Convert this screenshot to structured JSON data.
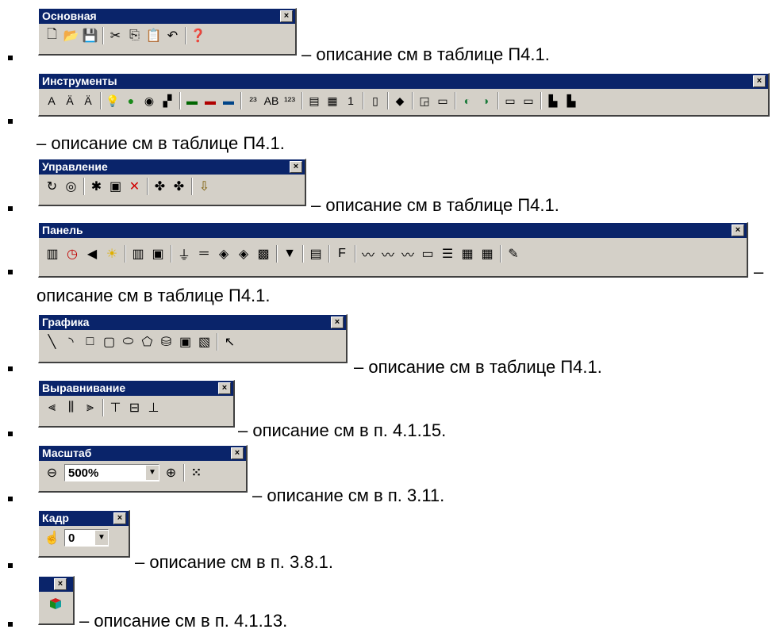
{
  "toolbars": [
    {
      "title": "Основная",
      "icons": [
        "new-icon",
        "open-icon",
        "save-icon",
        "|",
        "cut-icon",
        "copy-icon",
        "paste-icon",
        "undo-icon",
        "|",
        "help-icon"
      ],
      "desc": "– описание см в таблице П4.1."
    },
    {
      "title": "Инструменты",
      "icons": [
        "text-a-icon",
        "text-aa-icon",
        "text-aa2-icon",
        "|",
        "bulb-icon",
        "brush-icon",
        "dot-icon",
        "map-icon",
        "|",
        "num999-icon",
        "num999red-icon",
        "abc-icon",
        "|",
        "num23-icon",
        "ab-icon",
        "num123-icon",
        "|",
        "display-icon",
        "calc-icon",
        "num1-icon",
        "|",
        "gauge-icon",
        "|",
        "eraser-icon",
        "|",
        "frame-icon",
        "rect-icon",
        "|",
        "globe-icon",
        "globe2-icon",
        "|",
        "btn-icon",
        "btn2-icon",
        "|",
        "bars-icon",
        "bars2-icon"
      ],
      "desc": "– описание см в таблице П4.1."
    },
    {
      "title": "Управление",
      "icons": [
        "rotate-icon",
        "circle-icon",
        "|",
        "sparkle-icon",
        "props-icon",
        "delete-icon",
        "|",
        "link-icon",
        "link2-icon",
        "|",
        "import-icon"
      ],
      "desc": "– описание см в таблице П4.1."
    },
    {
      "title": "Панель",
      "icons": [
        "panel-icon",
        "clock-icon",
        "speaker-icon",
        "sun-icon",
        "|",
        "bars3-icon",
        "monitor-icon",
        "|",
        "filter-icon",
        "slider-icon",
        "valve-icon",
        "valve2-icon",
        "screen-icon",
        "|",
        "shield-icon",
        "|",
        "doc-icon",
        "|",
        "fmin-icon",
        "|",
        "trend-icon",
        "trend2-icon",
        "trend3-icon",
        "field-icon",
        "list-icon",
        "table-icon",
        "grid-icon",
        "|",
        "pen-icon"
      ],
      "desc": "–",
      "desc2": "описание см в таблице П4.1."
    },
    {
      "title": "Графика",
      "icons": [
        "line-icon",
        "arc-icon",
        "rectangle-icon",
        "rounded-rect-icon",
        "ellipse-icon",
        "pentagon-icon",
        "cylinder-icon",
        "frame2-icon",
        "image-icon",
        "|",
        "pointer-icon"
      ],
      "desc": "– описание см в таблице П4.1."
    },
    {
      "title": "Выравнивание",
      "icons": [
        "align-left-icon",
        "align-center-icon",
        "align-right-icon",
        "|",
        "align-top-icon",
        "align-middle-icon",
        "align-bottom-icon"
      ],
      "desc": "– описание см в п. 4.1.15."
    },
    {
      "title": "Масштаб",
      "zoom": {
        "value": "500%"
      },
      "desc": "– описание см в п. 3.11."
    },
    {
      "title": "Кадр",
      "frame": {
        "value": "0"
      },
      "desc": "– описание см в п. 3.8.1."
    },
    {
      "title": "",
      "icons": [
        "cube-icon"
      ],
      "desc": "– описание см в п. 4.1.13."
    }
  ],
  "close_glyph": "x",
  "colors": {
    "titlebar": "#0a246a",
    "face": "#d4d0c8"
  }
}
